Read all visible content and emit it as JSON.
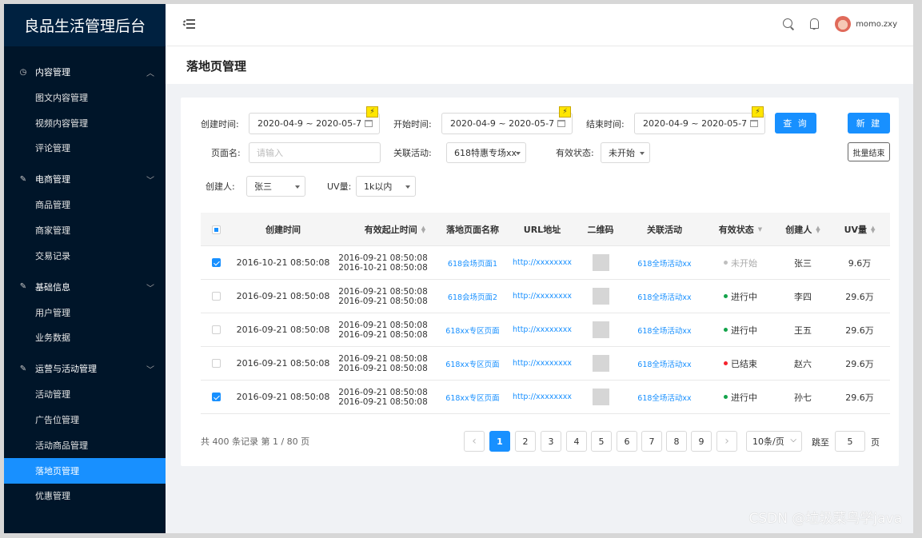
{
  "app": {
    "title": "良品生活管理后台"
  },
  "header": {
    "username": "momo.zxy"
  },
  "sidebar": {
    "groups": [
      {
        "label": "内容管理",
        "icon": "dashboard-icon",
        "expanded": true,
        "items": [
          "图文内容管理",
          "视频内容管理",
          "评论管理"
        ]
      },
      {
        "label": "电商管理",
        "icon": "edit-icon",
        "expanded": true,
        "items": [
          "商品管理",
          "商家管理",
          "交易记录"
        ]
      },
      {
        "label": "基础信息",
        "icon": "edit-icon",
        "expanded": true,
        "items": [
          "用户管理",
          "业务数据"
        ]
      },
      {
        "label": "运营与活动管理",
        "icon": "edit-icon",
        "expanded": true,
        "items": [
          "活动管理",
          "广告位管理",
          "活动商品管理",
          "落地页管理",
          "优惠管理"
        ]
      }
    ],
    "active_item": "落地页管理"
  },
  "page": {
    "title": "落地页管理"
  },
  "filters": {
    "create_time": {
      "label": "创建时间:",
      "value": "2020-04-9 ~ 2020-05-7"
    },
    "start_time": {
      "label": "开始时间:",
      "value": "2020-04-9 ~ 2020-05-7"
    },
    "end_time": {
      "label": "结束时间:",
      "value": "2020-04-9 ~ 2020-05-7"
    },
    "page_name": {
      "label": "页面名:",
      "placeholder": "请输入"
    },
    "activity": {
      "label": "关联活动:",
      "value": "618特惠专场xx"
    },
    "status": {
      "label": "有效状态:",
      "value": "未开始"
    },
    "creator": {
      "label": "创建人:",
      "value": "张三"
    },
    "uv": {
      "label": "UV量:",
      "value": "1k以内"
    },
    "flash_icon": "lightning-icon",
    "query_label": "查 询",
    "new_label": "新 建",
    "batch_end_label": "批量结束"
  },
  "table": {
    "columns": [
      "创建时间",
      "有效起止时间",
      "落地页面名称",
      "URL地址",
      "二维码",
      "关联活动",
      "有效状态",
      "创建人",
      "UV量"
    ],
    "rows": [
      {
        "checked": true,
        "created": "2016-10-21  08:50:08",
        "range_start": "2016-09-21  08:50:08",
        "range_end": "2016-10-21  08:50:08",
        "name": "618会场页面1",
        "url": "http://xxxxxxxx",
        "activity": "618全场活动xx",
        "status": "未开始",
        "status_color": "#bfbfbf",
        "creator": "张三",
        "uv": "9.6万"
      },
      {
        "checked": false,
        "created": "2016-09-21  08:50:08",
        "range_start": "2016-09-21  08:50:08",
        "range_end": "2016-09-21  08:50:08",
        "name": "618会场页面2",
        "url": "http://xxxxxxxx",
        "activity": "618全场活动xx",
        "status": "进行中",
        "status_color": "#13a34a",
        "creator": "李四",
        "uv": "29.6万"
      },
      {
        "checked": false,
        "created": "2016-09-21  08:50:08",
        "range_start": "2016-09-21  08:50:08",
        "range_end": "2016-09-21  08:50:08",
        "name": "618xx专区页面",
        "url": "http://xxxxxxxx",
        "activity": "618全场活动xx",
        "status": "进行中",
        "status_color": "#13a34a",
        "creator": "王五",
        "uv": "29.6万"
      },
      {
        "checked": false,
        "created": "2016-09-21  08:50:08",
        "range_start": "2016-09-21  08:50:08",
        "range_end": "2016-09-21  08:50:08",
        "name": "618xx专区页面",
        "url": "http://xxxxxxxx",
        "activity": "618全场活动xx",
        "status": "已结束",
        "status_color": "#f5222d",
        "creator": "赵六",
        "uv": "29.6万"
      },
      {
        "checked": true,
        "created": "2016-09-21  08:50:08",
        "range_start": "2016-09-21  08:50:08",
        "range_end": "2016-09-21  08:50:08",
        "name": "618xx专区页面",
        "url": "http://xxxxxxxx",
        "activity": "618全场活动xx",
        "status": "进行中",
        "status_color": "#13a34a",
        "creator": "孙七",
        "uv": "29.6万"
      }
    ]
  },
  "pagination": {
    "summary": "共 400 条记录 第 1 / 80 页",
    "pages": [
      "1",
      "2",
      "3",
      "4",
      "5",
      "6",
      "7",
      "8",
      "9"
    ],
    "current": "1",
    "page_size": "10条/页",
    "jump_label": "跳至",
    "jump_value": "5",
    "page_unit": "页"
  },
  "watermark": "CSDN @垃圾菜鸟学java"
}
